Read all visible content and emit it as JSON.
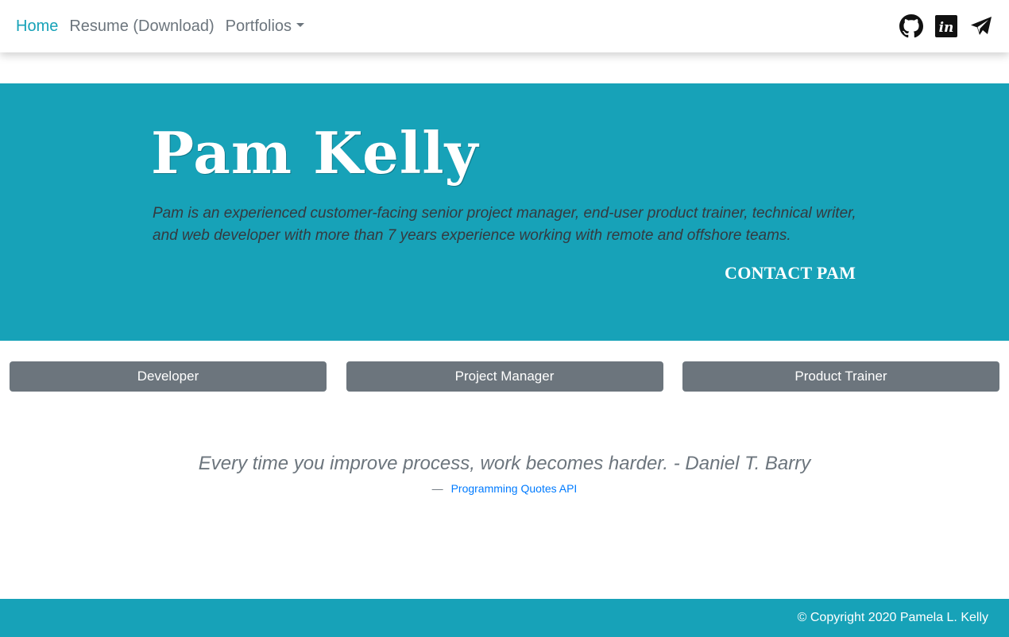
{
  "nav": {
    "home": "Home",
    "resume": "Resume (Download)",
    "portfolios": "Portfolios"
  },
  "social": {
    "icons": [
      "github-icon",
      "linkedin-icon",
      "telegram-icon"
    ]
  },
  "hero": {
    "title": "Pam Kelly",
    "description": "Pam is an experienced customer-facing senior project manager, end-user product trainer, technical writer, and web developer with more than 7 years experience working with remote and offshore teams.",
    "contact": "CONTACT PAM"
  },
  "roles": {
    "developer": "Developer",
    "project_manager": "Project Manager",
    "product_trainer": "Product Trainer"
  },
  "quote": {
    "text": "Every time you improve process, work becomes harder. - Daniel T. Barry",
    "dash": "—",
    "source": "Programming Quotes API"
  },
  "footer": {
    "copyright": "© Copyright 2020 Pamela L. Kelly"
  },
  "colors": {
    "accent": "#17a2b8",
    "button": "#6c757d",
    "link": "#007bff",
    "muted": "#6c757d",
    "dark_text": "#343a40"
  }
}
